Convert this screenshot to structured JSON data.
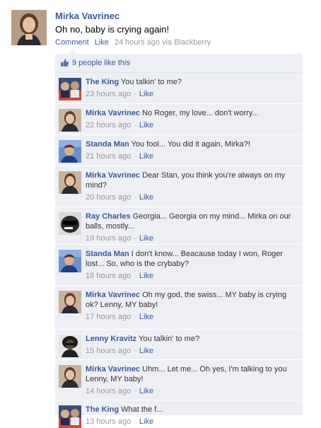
{
  "post": {
    "author": "Mirka Vavrinec",
    "message": "Oh no, baby is crying again!",
    "actions": {
      "comment": "Comment",
      "like": "Like",
      "timestamp": "24 hours ago via Blackberry"
    },
    "likes": {
      "icon": "thumbs-up-icon",
      "text": "9 people like this"
    }
  },
  "comments": [
    {
      "author": "The King",
      "text": "You talkin' to me?",
      "time": "23 hours ago",
      "like": "Like",
      "avatar": "king"
    },
    {
      "author": "Mirka Vavrinec",
      "text": "No Roger, my love... don't worry...",
      "time": "22 hours ago",
      "like": "Like",
      "avatar": "mirka"
    },
    {
      "author": "Standa Man",
      "text": "You fool... You did it again, Mirka?!",
      "time": "21 hours ago",
      "like": "Like",
      "avatar": "standa"
    },
    {
      "author": "Mirka Vavrinec",
      "text": "Dear Stan, you think you're always on my mind?",
      "time": "20 hours ago",
      "like": "Like",
      "avatar": "mirka"
    },
    {
      "author": "Ray Charles",
      "text": "Georgia... Georgia on my mind... Mirka on our balls, mostly...",
      "time": "19 hours ago",
      "like": "Like",
      "avatar": "ray"
    },
    {
      "author": "Standa Man",
      "text": "I don't know... Beacause today I won, Roger lost... So, who is the crybaby?",
      "time": "18 hours ago",
      "like": "Like",
      "avatar": "standa"
    },
    {
      "author": "Mirka Vavrinec",
      "text": "Oh my god, the swiss... MY baby is crying ok? Lenny, MY baby!",
      "time": "17 hours ago",
      "like": "Like",
      "avatar": "mirka"
    },
    {
      "author": "Lenny Kravitz",
      "text": "You talkin' to me?",
      "time": "15 hours ago",
      "like": "Like",
      "avatar": "lenny"
    },
    {
      "author": "Mirka Vavrinec",
      "text": "Uhm... Let me... Oh yes, I'm talking to you Lenny, MY baby!",
      "time": "14 hours ago",
      "like": "Like",
      "avatar": "mirka"
    },
    {
      "author": "The King",
      "text": "What the f...",
      "time": "13 hours ago",
      "like": "Like",
      "avatar": "king"
    }
  ],
  "colors": {
    "link": "#3b5998",
    "muted": "#999999",
    "feedback_bg": "#edeff4"
  }
}
